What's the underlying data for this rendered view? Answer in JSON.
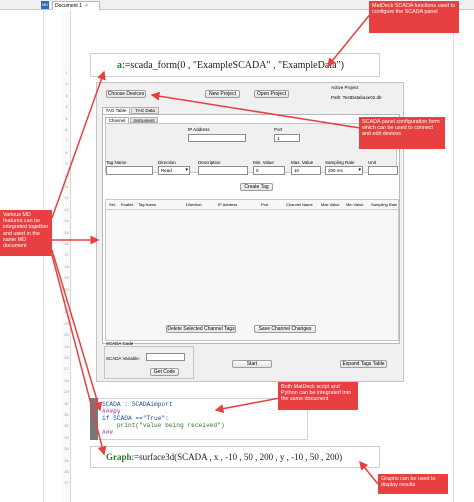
{
  "window": {
    "app_icon": "MD",
    "tab_title": "Document 1",
    "tab_close": "×"
  },
  "line_numbers": [
    "1",
    "2",
    "3",
    "4",
    "5",
    "6",
    "7",
    "8",
    "9",
    "10",
    "11",
    "12",
    "13",
    "14",
    "15",
    "16",
    "17",
    "18",
    "19",
    "20",
    "21",
    "22",
    "23",
    "24",
    "25",
    "26",
    "27",
    "28",
    "29",
    "30",
    "31",
    "32",
    "33",
    "34",
    "35",
    "36",
    "37"
  ],
  "formula1": {
    "var": "a",
    "assign": ":=",
    "call": "scada_form(0 , \"ExampleSCADA\" , \"ExampleData\")"
  },
  "scada": {
    "choose_devices": "Choose Devices",
    "new_project": "New Project",
    "open_project": "Open Project",
    "active_project_label": "Active Project",
    "active_project_value": "Path: TestDatabase02.db",
    "tabs": [
      "TAG Table",
      "TAG Data"
    ],
    "subtabs": [
      "Channel",
      "Instrument"
    ],
    "ip_label": "IP Address",
    "port_label": "Port",
    "port_value": "1",
    "fields": {
      "tag_name": "Tag Name",
      "direction": "Direction",
      "direction_value": "Read",
      "description": "Description",
      "min_value": "Min. Value",
      "min_value_value": "0",
      "max_value": "Max. Value",
      "max_value_value": "10",
      "sampling_rate": "Sampling Rate",
      "sampling_rate_value": "200 ms",
      "unit": "Unit"
    },
    "create_tag": "Create Tag",
    "table_headers": [
      "Sel.",
      "Enable",
      "Tag Name",
      "Direction",
      "IP Address",
      "Port",
      "Channel Name",
      "Max Value",
      "Min Value",
      "Sampling Rate"
    ],
    "delete_tags": "Delete Selected Channel Tags",
    "save_changes": "Save Channel Changes",
    "scada_code_label": "SCADA Code",
    "scada_variable_label": "SCADA Variable:",
    "get_code": "Get Code",
    "start": "Start",
    "expand_tags": "Expand Tags Table"
  },
  "code": {
    "lines": [
      "SCADA : SCADAimport",
      "###py",
      "if SCADA ==\"True\":",
      "    print(\"value being received\")",
      "###"
    ]
  },
  "formula2": {
    "var": "Graph",
    "assign": ":=",
    "call": "surface3d(SCADA , x , -10 , 50 , 200 , y , -10 , 50 , 200)"
  },
  "callouts": {
    "c1": "MatDeck SCADA functions used to configure the SCADA panel",
    "c2": "SCADA panel configuration form which can be used to connect and edit devices",
    "c3": "Various MD features can be integrated together and used in the same MD document",
    "c4": "Both MatDeck script and Python can be integrated into the same document",
    "c5": "Graphs can be used to display results"
  },
  "colors": {
    "callout": "#e84040",
    "keyword": "#2a7a2a",
    "panel": "#f0f0f0"
  }
}
